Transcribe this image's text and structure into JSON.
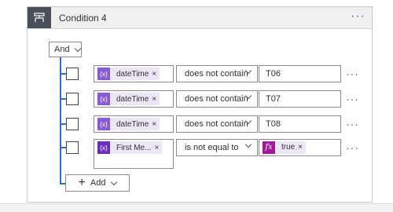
{
  "header": {
    "title": "Condition 4",
    "more_label": "···",
    "icon": "condition-branch-icon"
  },
  "group": {
    "operator_label": "And"
  },
  "rows": [
    {
      "token_label": "dateTime",
      "token_icon": "{x}",
      "operator": "does not contain",
      "value": "T06"
    },
    {
      "token_label": "dateTime",
      "token_icon": "{x}",
      "operator": "does not contain",
      "value": "T07"
    },
    {
      "token_label": "dateTime",
      "token_icon": "{x}",
      "operator": "does not contain",
      "value": "T08"
    },
    {
      "token_label": "First Me...",
      "token_icon": "{x}",
      "operator": "is not equal to",
      "value_token_label": "true",
      "value_token_icon": "fx"
    }
  ],
  "remove_label": "×",
  "row_more_label": "···",
  "add": {
    "plus": "+",
    "label": "Add"
  },
  "colors": {
    "accent": "#2e6fc1",
    "variable": "#8a5ad6",
    "expression": "#a3179b"
  }
}
